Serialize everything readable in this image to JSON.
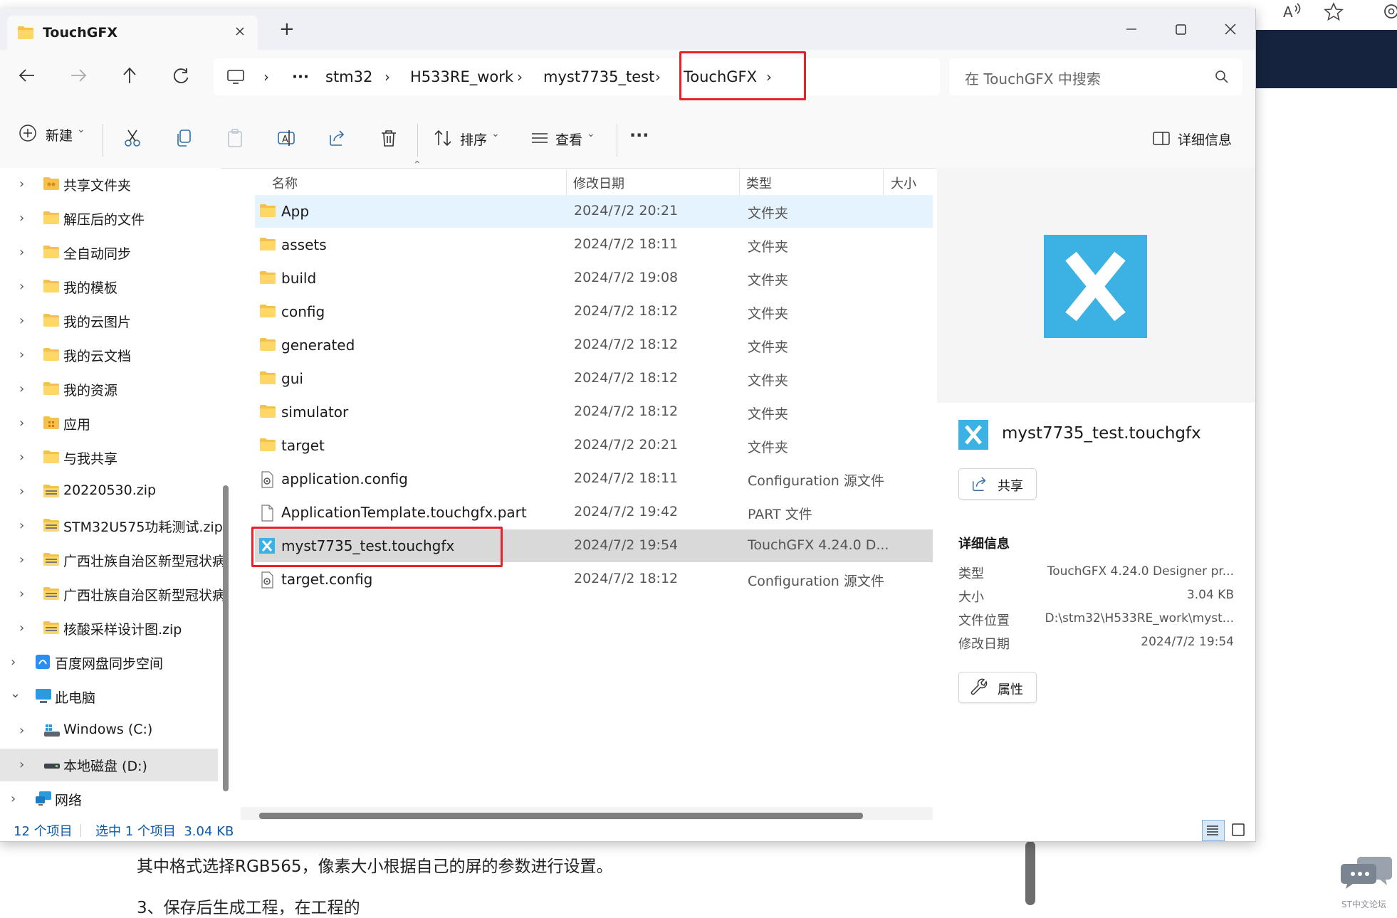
{
  "window": {
    "tab_title": "TouchGFX",
    "new_tab": "+",
    "controls": [
      "minimize",
      "maximize",
      "close"
    ]
  },
  "breadcrumb": {
    "items": [
      "stm32",
      "H533RE_work",
      "myst7735_test",
      "TouchGFX"
    ],
    "overflow": "···"
  },
  "search": {
    "placeholder": "在 TouchGFX 中搜索"
  },
  "toolbar": {
    "new_label": "新建",
    "sort_label": "排序",
    "view_label": "查看",
    "more": "···",
    "details_label": "详细信息"
  },
  "sidebar": {
    "items": [
      {
        "label": "共享文件夹",
        "icon": "shared-folder-icon"
      },
      {
        "label": "解压后的文件",
        "icon": "folder-icon"
      },
      {
        "label": "全自动同步",
        "icon": "folder-icon"
      },
      {
        "label": "我的模板",
        "icon": "folder-icon"
      },
      {
        "label": "我的云图片",
        "icon": "folder-icon"
      },
      {
        "label": "我的云文档",
        "icon": "folder-icon"
      },
      {
        "label": "我的资源",
        "icon": "folder-icon"
      },
      {
        "label": "应用",
        "icon": "app-folder-icon"
      },
      {
        "label": "与我共享",
        "icon": "folder-icon"
      },
      {
        "label": "20220530.zip",
        "icon": "zip-icon"
      },
      {
        "label": "STM32U575功耗测试.zip",
        "icon": "zip-icon"
      },
      {
        "label": "广西壮族自治区新型冠状病",
        "icon": "zip-icon"
      },
      {
        "label": "广西壮族自治区新型冠状病",
        "icon": "zip-icon"
      },
      {
        "label": "核酸采样设计图.zip",
        "icon": "zip-icon"
      },
      {
        "label": "百度网盘同步空间",
        "icon": "baidu-sync-icon"
      },
      {
        "label": "此电脑",
        "icon": "computer-icon"
      },
      {
        "label": "Windows (C:)",
        "icon": "windows-drive-icon"
      },
      {
        "label": "本地磁盘 (D:)",
        "icon": "local-drive-icon"
      },
      {
        "label": "网络",
        "icon": "network-icon"
      }
    ]
  },
  "columns": {
    "name": "名称",
    "date": "修改日期",
    "type": "类型",
    "size": "大小"
  },
  "files": [
    {
      "name": "App",
      "date": "2024/7/2 20:21",
      "type": "文件夹",
      "icon": "folder-icon"
    },
    {
      "name": "assets",
      "date": "2024/7/2 18:11",
      "type": "文件夹",
      "icon": "folder-icon"
    },
    {
      "name": "build",
      "date": "2024/7/2 19:08",
      "type": "文件夹",
      "icon": "folder-icon"
    },
    {
      "name": "config",
      "date": "2024/7/2 18:12",
      "type": "文件夹",
      "icon": "folder-icon"
    },
    {
      "name": "generated",
      "date": "2024/7/2 18:12",
      "type": "文件夹",
      "icon": "folder-icon"
    },
    {
      "name": "gui",
      "date": "2024/7/2 18:12",
      "type": "文件夹",
      "icon": "folder-icon"
    },
    {
      "name": "simulator",
      "date": "2024/7/2 18:12",
      "type": "文件夹",
      "icon": "folder-icon"
    },
    {
      "name": "target",
      "date": "2024/7/2 20:21",
      "type": "文件夹",
      "icon": "folder-icon"
    },
    {
      "name": "application.config",
      "date": "2024/7/2 18:11",
      "type": "Configuration 源文件",
      "icon": "config-file-icon"
    },
    {
      "name": "ApplicationTemplate.touchgfx.part",
      "date": "2024/7/2 19:42",
      "type": "PART 文件",
      "icon": "blank-file-icon"
    },
    {
      "name": "myst7735_test.touchgfx",
      "date": "2024/7/2 19:54",
      "type": "TouchGFX 4.24.0 D...",
      "icon": "touchgfx-icon"
    },
    {
      "name": "target.config",
      "date": "2024/7/2 18:12",
      "type": "Configuration 源文件",
      "icon": "config-file-icon"
    }
  ],
  "details": {
    "file_name": "myst7735_test.touchgfx",
    "share_label": "共享",
    "section_title": "详细信息",
    "type_key": "类型",
    "type_val": "TouchGFX 4.24.0 Designer pr...",
    "size_key": "大小",
    "size_val": "3.04 KB",
    "location_key": "文件位置",
    "location_val": "D:\\stm32\\H533RE_work\\myst...",
    "modified_key": "修改日期",
    "modified_val": "2024/7/2 19:54",
    "properties_label": "属性"
  },
  "status": {
    "count": "12 个项目",
    "selection": "选中 1 个项目  3.04 KB"
  },
  "background": {
    "line1": "其中格式选择RGB565，像素大小根据自己的屏的参数进行设置。",
    "line2": "3、保存后生成工程，在工程的",
    "forum_label": "ST中文论坛"
  },
  "colors": {
    "accent": "#0067c0",
    "highlight": "#e8202a",
    "touchgfx_blue": "#3bb2e3",
    "folder_yellow": "#f5c14b",
    "selected_row": "#d9d9d9",
    "hover_row": "#e5f3ff"
  }
}
